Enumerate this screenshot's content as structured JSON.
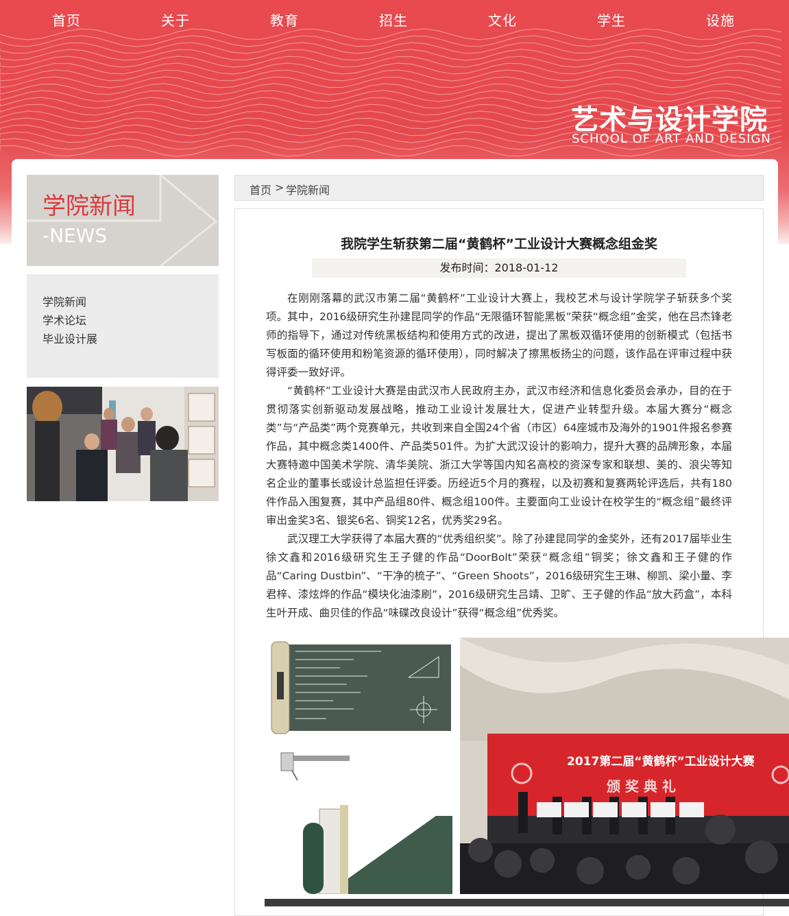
{
  "nav": {
    "items": [
      "首页",
      "关于",
      "教育",
      "招生",
      "文化",
      "学生",
      "设施"
    ]
  },
  "brand": {
    "name_cn": "艺术与设计学院",
    "name_en": "SCHOOL OF ART AND DESIGN",
    "accent_color": "#e84a4f"
  },
  "sidebar": {
    "section_title_cn": "学院新闻",
    "section_title_en": "-NEWS",
    "menu": [
      "学院新闻",
      "学术论坛",
      "毕业设计展"
    ]
  },
  "breadcrumb": {
    "home": "首页",
    "separator": ">",
    "current": "学院新闻"
  },
  "article": {
    "title": "我院学生斩获第二届“黄鹤杯”工业设计大赛概念组金奖",
    "date": "发布时间：2018-01-12",
    "paragraphs": [
      "在刚刚落幕的武汉市第二届“黄鹤杯”工业设计大赛上，我校艺术与设计学院学子斩获多个奖项。其中，2016级研究生孙建昆同学的作品“无限循环智能黑板”荣获“概念组”金奖，他在吕杰锋老师的指导下，通过对传统黑板结构和使用方式的改进，提出了黑板双循环使用的创新模式（包括书写板面的循环使用和粉笔资源的循环使用），同时解决了擦黑板扬尘的问题，该作品在评审过程中获得评委一致好评。",
      "“黄鹤杯”工业设计大赛是由武汉市人民政府主办，武汉市经济和信息化委员会承办，目的在于贯彻落实创新驱动发展战略，推动工业设计发展壮大，促进产业转型升级。本届大赛分“概念类”与“产品类”两个竞赛单元，共收到来自全国24个省（市区）64座城市及海外的1901件报名参赛作品，其中概念类1400件、产品类501件。为扩大武汉设计的影响力，提升大赛的品牌形象，本届大赛特邀中国美术学院、清华美院、浙江大学等国内知名高校的资深专家和联想、美的、浪尖等知名企业的董事长或设计总监担任评委。历经近5个月的赛程，以及初赛和复赛两轮评选后，共有180件作品入围复赛，其中产品组80件、概念组100件。主要面向工业设计在校学生的“概念组”最终评审出金奖3名、银奖6名、铜奖12名，优秀奖29名。",
      "武汉理工大学获得了本届大赛的“优秀组织奖”。除了孙建昆同学的金奖外，还有2017届毕业生徐文鑫和2016级研究生王子健的作品“DoorBolt”荣获“概念组”铜奖；徐文鑫和王子健的作品“Caring Dustbin”、“干净的梳子”、“Green Shoots”，2016级研究生王琳、柳凯、梁小量、李君梓、漆炫烨的作品“模块化油漆刷”，2016级研究生吕靖、卫旷、王子健的作品“放大药盒”，本科生叶开成、曲贝佳的作品“味碟改良设计”获得“概念组”优秀奖。"
    ],
    "banner_text": "2017第二届“黄鹤杯”工业设计大赛",
    "banner_sub": "颁 奖 典 礼"
  }
}
